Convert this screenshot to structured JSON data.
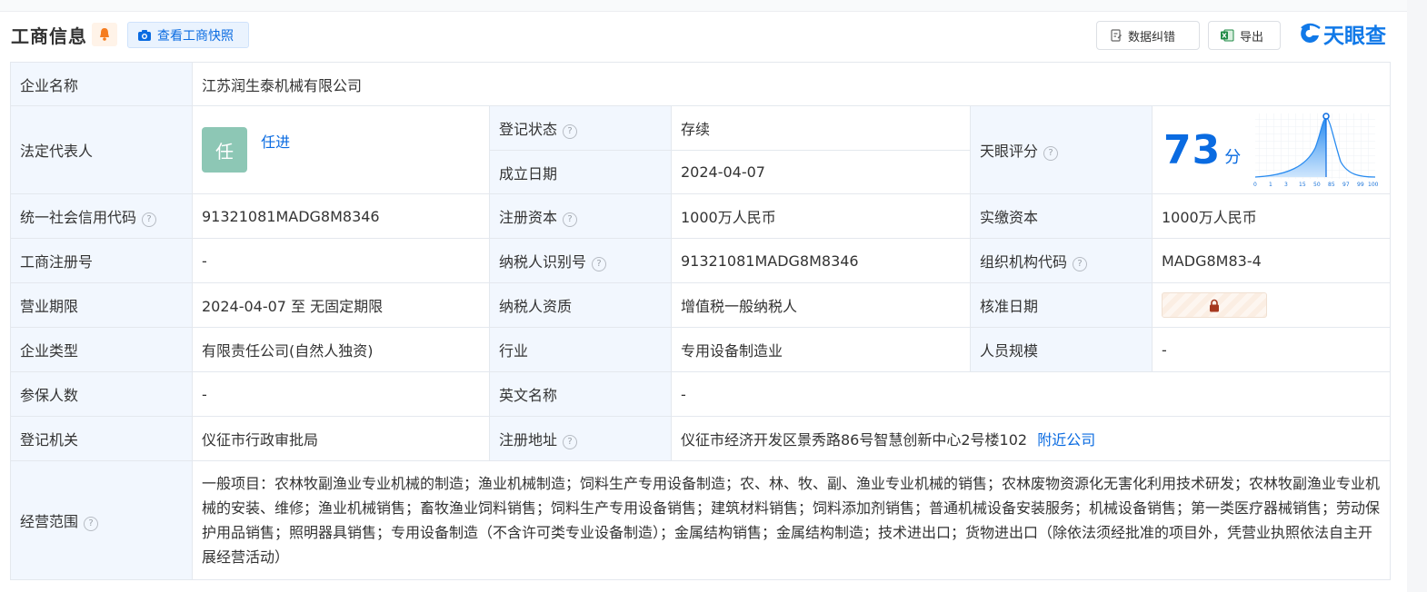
{
  "header": {
    "title": "工商信息",
    "snapshot_label": "查看工商快照",
    "correct_label": "数据纠错",
    "export_label": "导出",
    "logo_text": "天眼查"
  },
  "colors": {
    "accent": "#0a6be1",
    "status_green": "#14a33d",
    "key_bg": "#f2f7fe",
    "avatar_bg": "#8dc7b5"
  },
  "info": {
    "company_name_label": "企业名称",
    "company_name": "江苏润生泰机械有限公司",
    "legal_rep_label": "法定代表人",
    "legal_rep_avatar": "任",
    "legal_rep_name": "任进",
    "reg_status_label": "登记状态",
    "reg_status": "存续",
    "est_date_label": "成立日期",
    "est_date": "2024-04-07",
    "score_label": "天眼评分",
    "score": "73",
    "score_unit": "分",
    "score_axis": [
      "0",
      "1",
      "3",
      "15",
      "50",
      "85",
      "97",
      "99",
      "100"
    ],
    "credit_code_label": "统一社会信用代码",
    "credit_code": "91321081MADG8M8346",
    "reg_capital_label": "注册资本",
    "reg_capital": "1000万人民币",
    "paid_capital_label": "实缴资本",
    "paid_capital": "1000万人民币",
    "biz_reg_no_label": "工商注册号",
    "biz_reg_no": "-",
    "taxpayer_id_label": "纳税人识别号",
    "taxpayer_id": "91321081MADG8M8346",
    "org_code_label": "组织机构代码",
    "org_code": "MADG8M83-4",
    "term_label": "营业期限",
    "term": "2024-04-07 至 无固定期限",
    "taxpayer_qual_label": "纳税人资质",
    "taxpayer_qual": "增值税一般纳税人",
    "approval_date_label": "核准日期",
    "company_type_label": "企业类型",
    "company_type": "有限责任公司(自然人独资)",
    "industry_label": "行业",
    "industry": "专用设备制造业",
    "staff_size_label": "人员规模",
    "staff_size": "-",
    "insured_label": "参保人数",
    "insured": "-",
    "english_name_label": "英文名称",
    "english_name": "-",
    "reg_authority_label": "登记机关",
    "reg_authority": "仪征市行政审批局",
    "reg_address_label": "注册地址",
    "reg_address": "仪征市经济开发区景秀路86号智慧创新中心2号楼102",
    "nearby_label": "附近公司",
    "scope_label": "经营范围",
    "scope": "一般项目：农林牧副渔业专业机械的制造；渔业机械制造；饲料生产专用设备制造；农、林、牧、副、渔业专业机械的销售；农林废物资源化无害化利用技术研发；农林牧副渔业专业机械的安装、维修；渔业机械销售；畜牧渔业饲料销售；饲料生产专用设备销售；建筑材料销售；饲料添加剂销售；普通机械设备安装服务；机械设备销售；第一类医疗器械销售；劳动保护用品销售；照明器具销售；专用设备制造（不含许可类专业设备制造）；金属结构销售；金属结构制造；技术进出口；货物进出口（除依法须经批准的项目外，凭营业执照依法自主开展经营活动）"
  }
}
